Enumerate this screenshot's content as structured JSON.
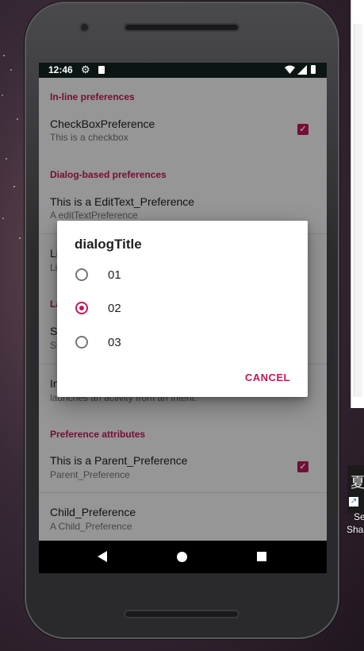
{
  "status_bar": {
    "time": "12:46"
  },
  "preferences": {
    "inline_category": "In-line preferences",
    "checkbox_title": "CheckBoxPreference",
    "checkbox_summary": "This is a checkbox",
    "dialog_category": "Dialog-based preferences",
    "edittext_title": "This is a EditText_Preference",
    "edittext_summary": "A editTextPreference",
    "list_title_partial": "Li",
    "list_summary_partial": "Li",
    "launch_category_partial": "La",
    "screen_title_partial": "S",
    "screen_summary_partial": "Sh",
    "intent_title_partial": "In",
    "intent_summary": "launches an activity from an Intent.",
    "attributes_category": "Preference attributes",
    "parent_title": "This is a Parent_Preference",
    "parent_summary": "Parent_Preference",
    "child_title": "Child_Preference",
    "child_summary": "A Child_Preference"
  },
  "dialog": {
    "title": "dialogTitle",
    "options": [
      {
        "label": "01",
        "selected": false
      },
      {
        "label": "02",
        "selected": true
      },
      {
        "label": "03",
        "selected": false
      }
    ],
    "cancel_label": "CANCEL"
  },
  "desktop": {
    "shortcut_label_1": "Se",
    "shortcut_label_2": "Sha"
  },
  "colors": {
    "accent": "#c2185b",
    "status_bar": "#0b1513"
  }
}
